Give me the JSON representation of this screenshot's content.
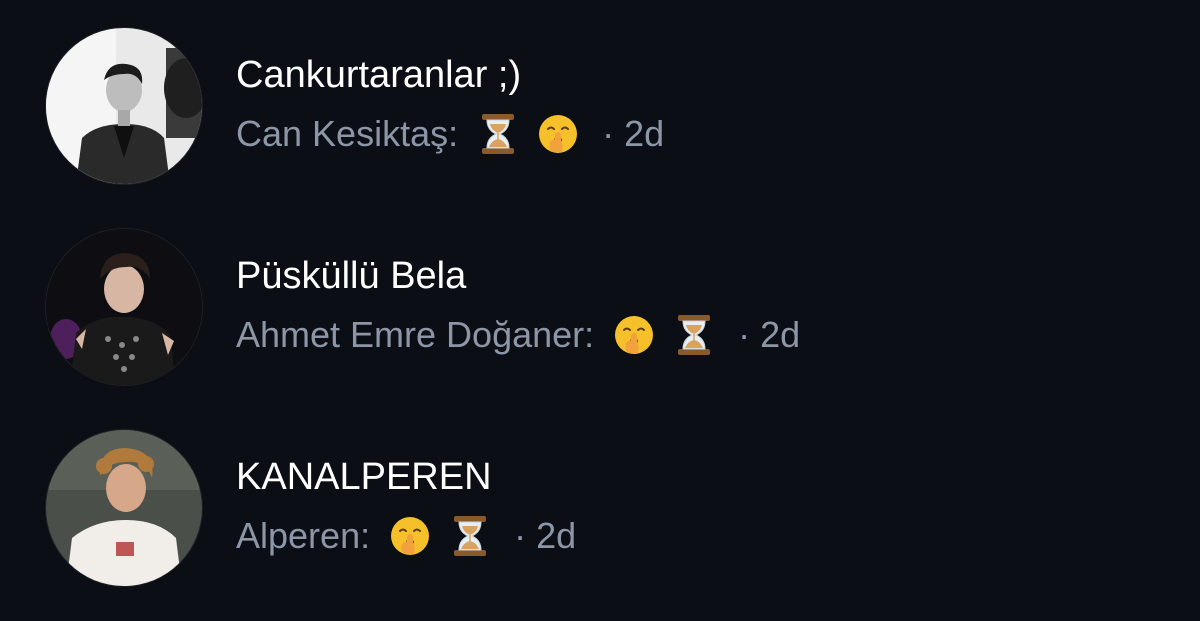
{
  "conversations": [
    {
      "title": "Cankurtaranlar ;)",
      "sender": "Can Kesiktaş:",
      "emojis": [
        "hourglass-icon",
        "shushing-face-icon"
      ],
      "time": "· 2d",
      "avatar": "group-avatar-photo"
    },
    {
      "title": "Püsküllü Bela",
      "sender": "Ahmet Emre Doğaner:",
      "emojis": [
        "shushing-face-icon",
        "hourglass-icon"
      ],
      "time": "· 2d",
      "avatar": "group-avatar-photo"
    },
    {
      "title": "KANALPEREN",
      "sender": "Alperen:",
      "emojis": [
        "shushing-face-icon",
        "hourglass-icon"
      ],
      "time": "· 2d",
      "avatar": "group-avatar-photo"
    }
  ],
  "colors": {
    "background": "#0b0e14",
    "title": "#ffffff",
    "subtitle": "#8d96a6"
  }
}
